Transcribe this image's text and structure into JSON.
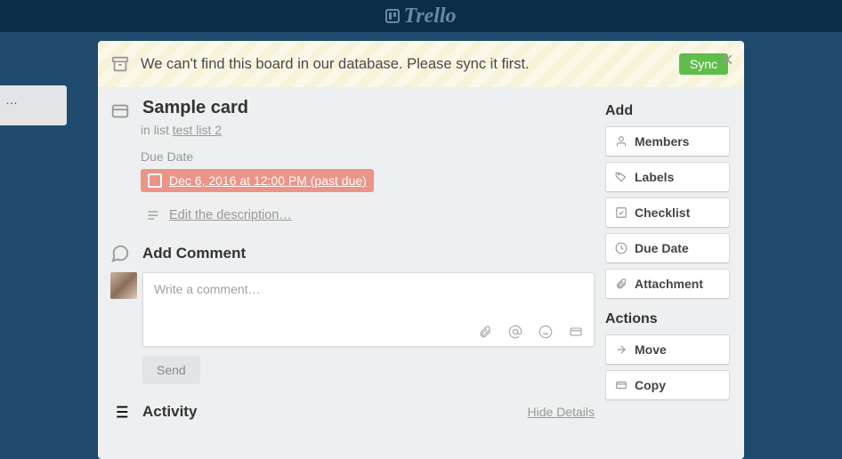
{
  "app": {
    "name": "Trello"
  },
  "banner": {
    "message": "We can't find this board in our database. Please sync it first.",
    "sync_label": "Sync"
  },
  "card": {
    "title": "Sample card",
    "in_list_prefix": "in list ",
    "list_name": "test list 2",
    "due_label": "Due Date",
    "due_value": "Dec 6, 2016 at 12:00 PM (past due)",
    "edit_desc": "Edit the description…"
  },
  "comment": {
    "heading": "Add Comment",
    "placeholder": "Write a comment…",
    "send": "Send"
  },
  "activity": {
    "heading": "Activity",
    "hide": "Hide Details"
  },
  "sidebar": {
    "add_heading": "Add",
    "add_items": [
      {
        "label": "Members"
      },
      {
        "label": "Labels"
      },
      {
        "label": "Checklist"
      },
      {
        "label": "Due Date"
      },
      {
        "label": "Attachment"
      }
    ],
    "actions_heading": "Actions",
    "action_items": [
      {
        "label": "Move"
      },
      {
        "label": "Copy"
      }
    ]
  },
  "list_stub": "…"
}
